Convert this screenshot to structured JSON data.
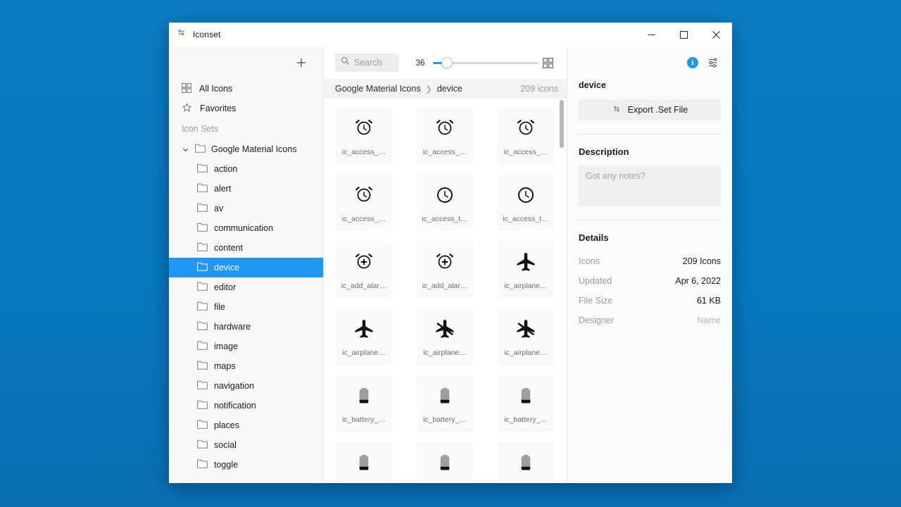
{
  "window": {
    "title": "Iconset",
    "logo_icon": "pinwheel-logo-icon",
    "minimize_label": "—",
    "maximize_label": "□",
    "close_label": "✕"
  },
  "sidebar": {
    "add_label": "+",
    "nav": [
      {
        "label": "All Icons",
        "icon": "grid-icon"
      },
      {
        "label": "Favorites",
        "icon": "star-icon"
      }
    ],
    "section_label": "Icon Sets",
    "tree": {
      "label": "Google Material Icons",
      "icon": "folder-icon",
      "expanded_icon": "chevron-down-icon",
      "children": [
        {
          "label": "action"
        },
        {
          "label": "alert"
        },
        {
          "label": "av"
        },
        {
          "label": "communication"
        },
        {
          "label": "content"
        },
        {
          "label": "device"
        },
        {
          "label": "editor"
        },
        {
          "label": "file"
        },
        {
          "label": "hardware"
        },
        {
          "label": "image"
        },
        {
          "label": "maps"
        },
        {
          "label": "navigation"
        },
        {
          "label": "notification"
        },
        {
          "label": "places"
        },
        {
          "label": "social"
        },
        {
          "label": "toggle"
        }
      ],
      "selected": "device"
    }
  },
  "toolbar": {
    "search_placeholder": "Search",
    "search_value": "",
    "search_icon": "search-icon",
    "zoom_value": "36",
    "slider_percent": 12,
    "view_toggle_icon": "grid-view-icon"
  },
  "breadcrumb": {
    "root": "Google Material Icons",
    "separator": "❯",
    "current": "device",
    "count": "209 icons"
  },
  "grid": {
    "tiles": [
      {
        "caption": "ic_access_…",
        "glyph": "alarm"
      },
      {
        "caption": "ic_access_…",
        "glyph": "alarm"
      },
      {
        "caption": "ic_access_…",
        "glyph": "alarm"
      },
      {
        "caption": "ic_access_…",
        "glyph": "alarm"
      },
      {
        "caption": "ic_access_t…",
        "glyph": "clock"
      },
      {
        "caption": "ic_access_t…",
        "glyph": "clock"
      },
      {
        "caption": "ic_add_alar…",
        "glyph": "add-alarm"
      },
      {
        "caption": "ic_add_alar…",
        "glyph": "add-alarm"
      },
      {
        "caption": "ic_airplane…",
        "glyph": "airplane"
      },
      {
        "caption": "ic_airplane…",
        "glyph": "airplane"
      },
      {
        "caption": "ic_airplane…",
        "glyph": "airplane-off"
      },
      {
        "caption": "ic_airplane…",
        "glyph": "airplane-off"
      },
      {
        "caption": "ic_battery_…",
        "glyph": "battery"
      },
      {
        "caption": "ic_battery_…",
        "glyph": "battery"
      },
      {
        "caption": "ic_battery_…",
        "glyph": "battery"
      },
      {
        "caption": "",
        "glyph": "battery"
      },
      {
        "caption": "",
        "glyph": "battery"
      },
      {
        "caption": "",
        "glyph": "battery"
      }
    ]
  },
  "detail": {
    "info_icon": "info-icon",
    "info_label": "i",
    "preferences_icon": "sliders-icon",
    "set_name": "device",
    "export_label": "Export .Set File",
    "export_icon": "pinwheel-logo-icon",
    "description_heading": "Description",
    "notes_placeholder": "Got any notes?",
    "details_heading": "Details",
    "rows": [
      {
        "key": "Icons",
        "value": "209 Icons",
        "muted": false
      },
      {
        "key": "Updated",
        "value": "Apr 6, 2022",
        "muted": false
      },
      {
        "key": "File Size",
        "value": "61 KB",
        "muted": false
      },
      {
        "key": "Designer",
        "value": "Name",
        "muted": true
      }
    ]
  },
  "colors": {
    "desktop": "#0a7bc4",
    "accent": "#2196f3",
    "selection": "#2196f3",
    "info_blue": "#1e97e6"
  }
}
